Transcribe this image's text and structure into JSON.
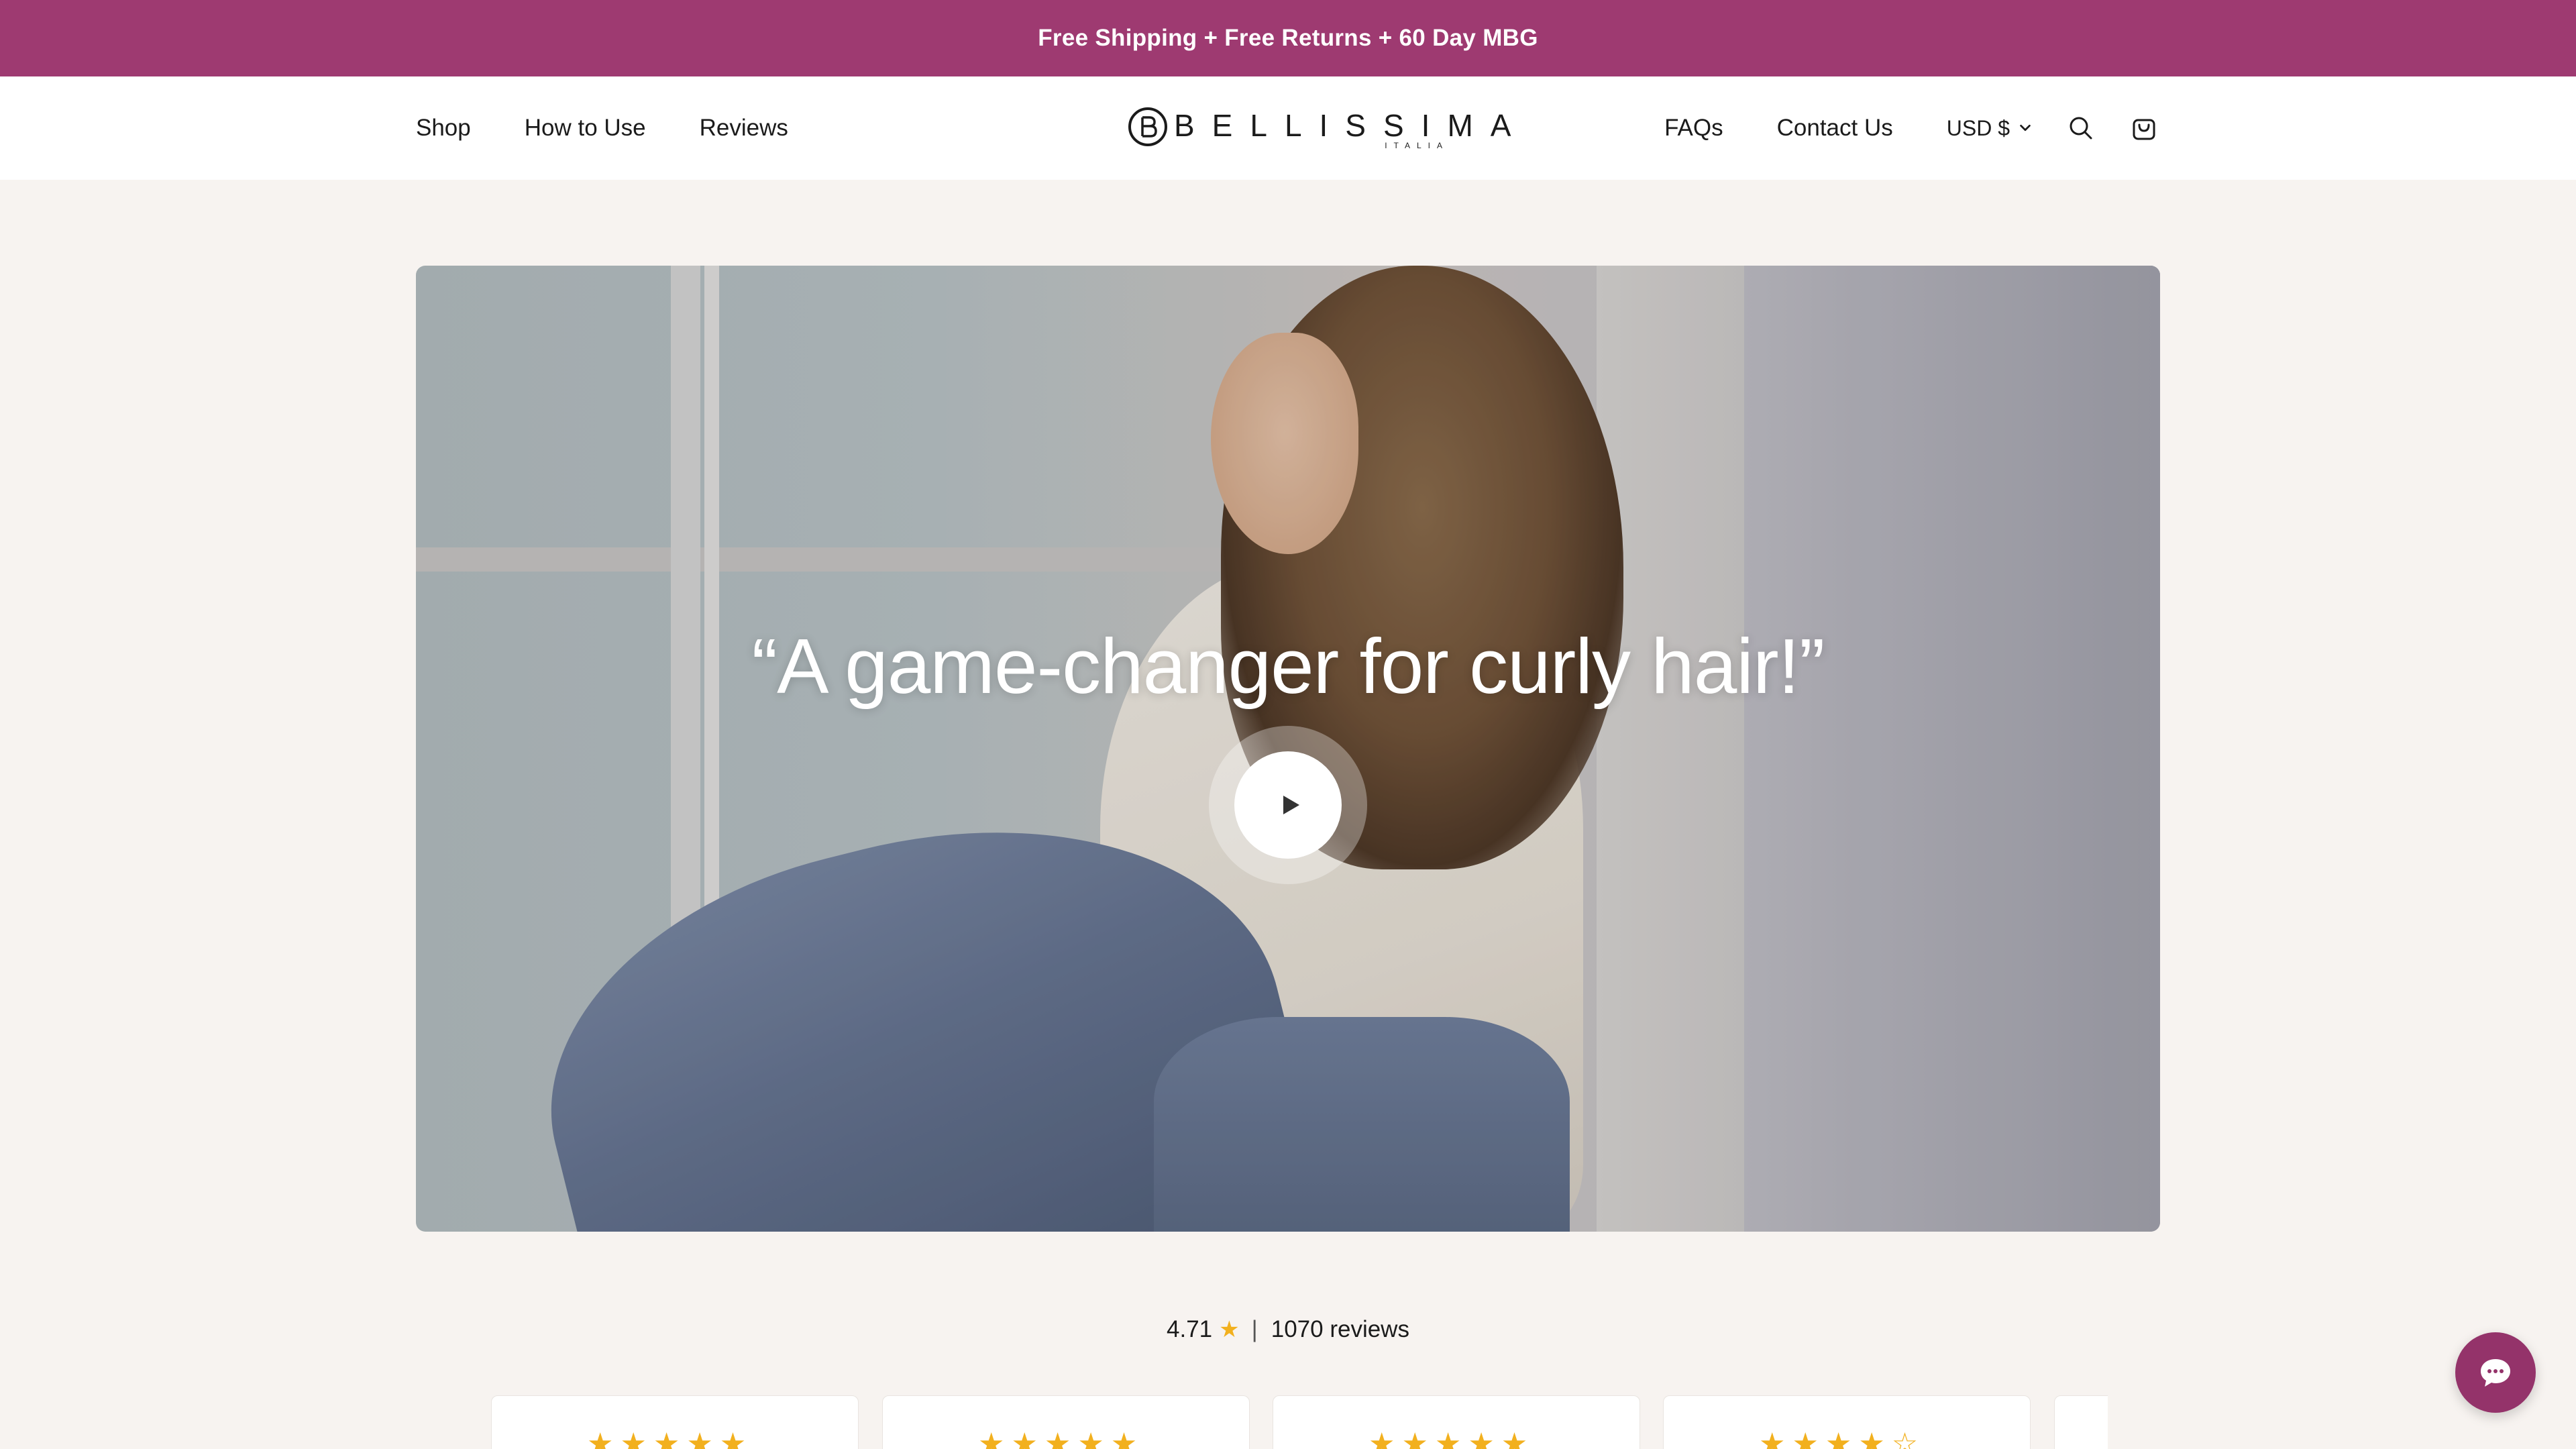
{
  "announcement": {
    "text": "Free Shipping + Free Returns + 60 Day MBG",
    "background": "#9e3a71"
  },
  "header": {
    "nav_left": [
      "Shop",
      "How to Use",
      "Reviews"
    ],
    "logo": {
      "wordmark": "BELLISSIMA",
      "sub": "ITALIA"
    },
    "nav_right": [
      "FAQs",
      "Contact Us"
    ],
    "currency": "USD $",
    "icons": [
      "search-icon",
      "cart-icon",
      "chevron-down-icon"
    ]
  },
  "hero": {
    "quote": "“A game-changer for curly hair!”",
    "play_icon": "play-icon"
  },
  "reviews_summary": {
    "rating": "4.71",
    "separator": "|",
    "count": "1070 reviews",
    "star_color": "#f2b01e"
  },
  "review_cards": [
    {
      "stars": "★★★★★",
      "rating": 5
    },
    {
      "stars": "★★★★★",
      "rating": 5
    },
    {
      "stars": "★★★★★",
      "rating": 5
    },
    {
      "stars": "★★★★☆",
      "rating": 4
    },
    {
      "stars": "",
      "rating": null
    }
  ],
  "chat": {
    "icon": "chat-bubble-icon",
    "color": "#94336a"
  }
}
